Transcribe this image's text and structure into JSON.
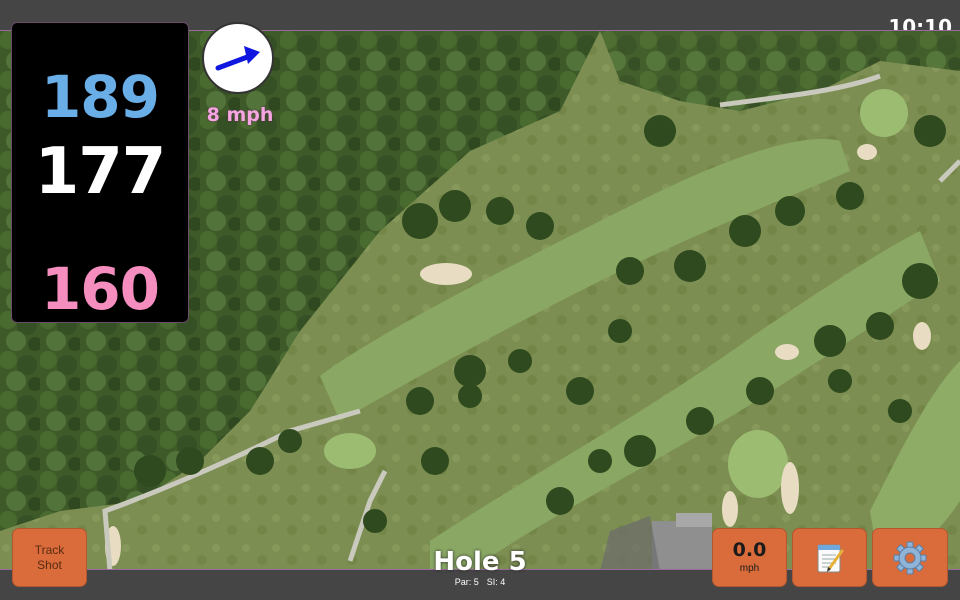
{
  "status": {
    "time": "10:10"
  },
  "distances": {
    "back": "189",
    "middle": "177",
    "front": "160"
  },
  "wind": {
    "speed": "8 mph",
    "icon": "wind-direction-arrow-icon",
    "arrow_color": "#1018e0"
  },
  "hole": {
    "title": "Hole 5",
    "par": "Par: 5",
    "si": "SI: 4"
  },
  "buttons": {
    "track_shot_line1": "Track",
    "track_shot_line2": "Shot",
    "speed_value": "0.0",
    "speed_unit": "mph",
    "notes_icon": "notepad-icon",
    "settings_icon": "gear-icon"
  },
  "colors": {
    "button": "#d96c3a",
    "back_distance": "#6aaee8",
    "front_distance": "#f58ebf",
    "wind_text": "#f5a6e0"
  }
}
